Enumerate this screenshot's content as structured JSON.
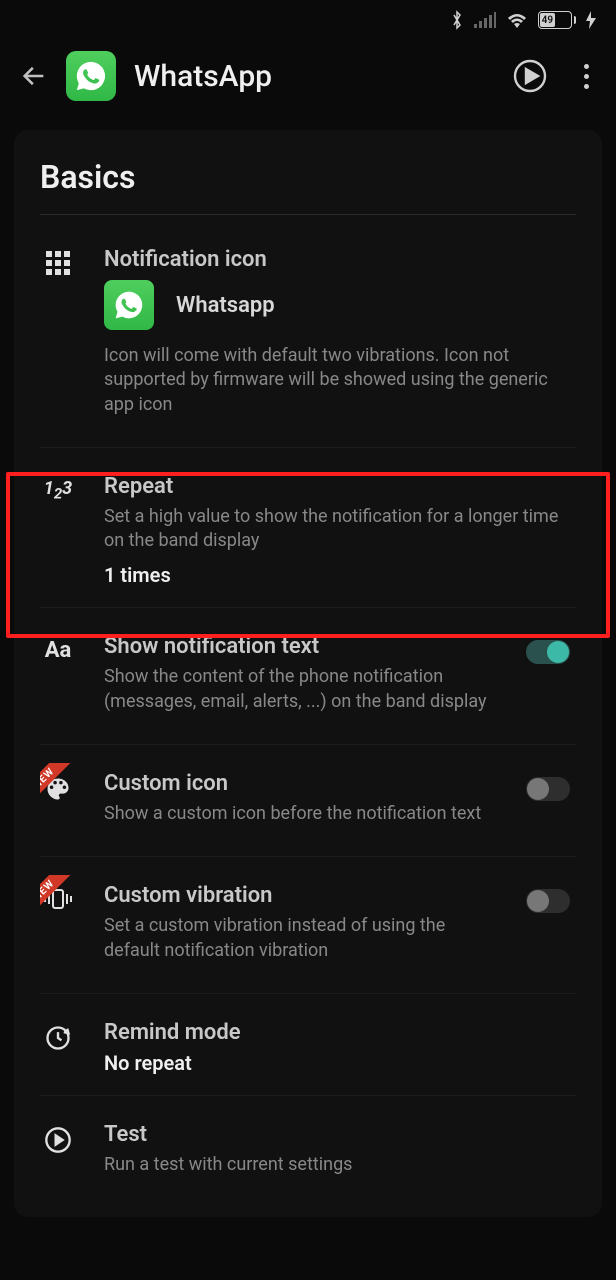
{
  "statusBar": {
    "battery": "49"
  },
  "header": {
    "title": "WhatsApp"
  },
  "section": {
    "title": "Basics"
  },
  "items": {
    "notifIcon": {
      "title": "Notification icon",
      "appLabel": "Whatsapp",
      "desc": "Icon will come with default two vibrations. Icon not supported by firmware will be showed using the generic app icon"
    },
    "repeat": {
      "title": "Repeat",
      "desc": "Set a high value to show the notification for a longer time on the band display",
      "value": "1 times"
    },
    "showText": {
      "title": "Show notification text",
      "desc": "Show the content of the phone notification (messages, email, alerts, ...) on the band display"
    },
    "customIcon": {
      "title": "Custom icon",
      "desc": "Show a custom icon before the notification text",
      "badge": "NEW"
    },
    "customVib": {
      "title": "Custom vibration",
      "desc": "Set a custom vibration instead of using the default notification vibration",
      "badge": "NEW"
    },
    "remind": {
      "title": "Remind mode",
      "value": "No repeat"
    },
    "test": {
      "title": "Test",
      "desc": "Run a test with current settings"
    }
  }
}
